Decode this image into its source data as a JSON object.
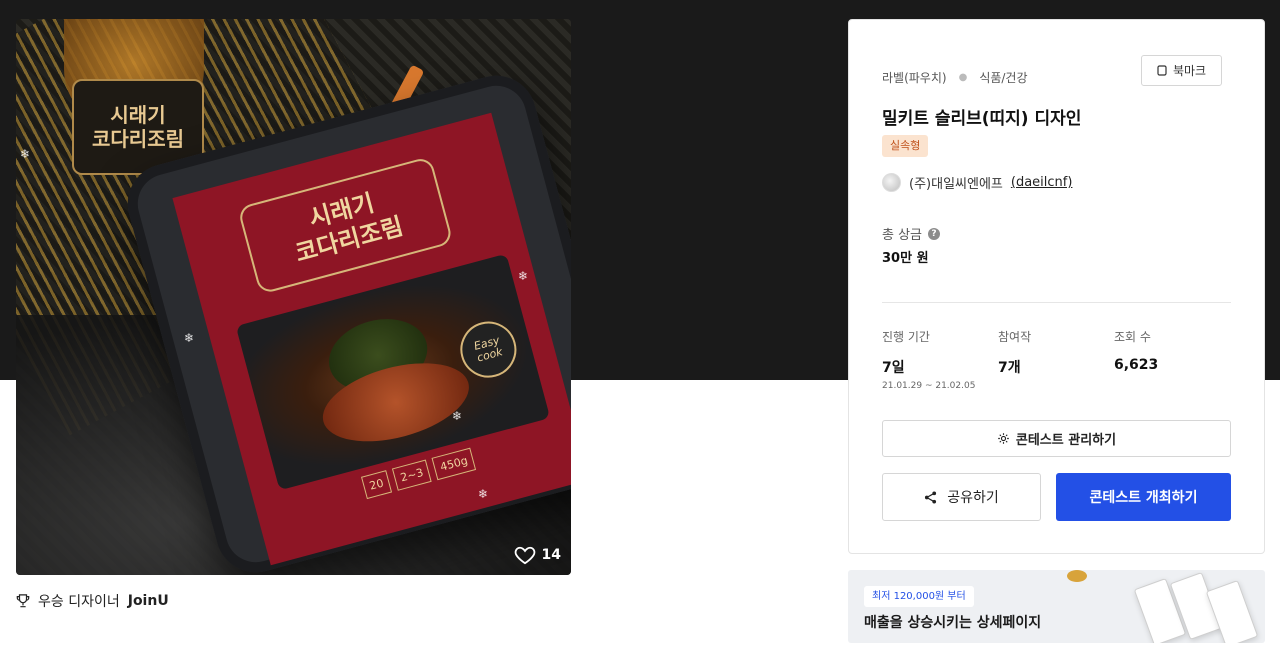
{
  "hero": {
    "logo_text": "시래기\n코다리조림",
    "label_title": "시래기\n코다리조림",
    "badge_text": "Easy\ncook",
    "specs": [
      "20",
      "2~3",
      "450g"
    ],
    "like_count": "14"
  },
  "winner": {
    "prefix": "우승 디자이너",
    "name": "JoinU"
  },
  "contest": {
    "category_primary": "라벨(파우치)",
    "category_secondary": "식품/건강",
    "bookmark_label": "북마크",
    "title": "밀키트 슬리브(띠지) 디자인",
    "tag": "실속형",
    "host_name": "(주)대일씨엔에프",
    "host_handle": "(daeilcnf)",
    "prize_label": "총 상금",
    "prize_value": "30만 원",
    "stats": {
      "period_label": "진행 기간",
      "period_value": "7일",
      "period_dates": "21.01.29 ~ 21.02.05",
      "participants_label": "참여작",
      "participants_value": "7개",
      "views_label": "조회 수",
      "views_value": "6,623"
    },
    "manage_label": "콘테스트 관리하기",
    "share_label": "공유하기",
    "host_contest_label": "콘테스트 개최하기"
  },
  "banner": {
    "pill": "최저 120,000원 부터",
    "headline": "매출을 상승시키는 상세페이지"
  },
  "colors": {
    "primary": "#2350e6",
    "tag_bg": "#fbe3cf",
    "tag_text": "#c0521c",
    "top_band": "#1a1a1a"
  }
}
